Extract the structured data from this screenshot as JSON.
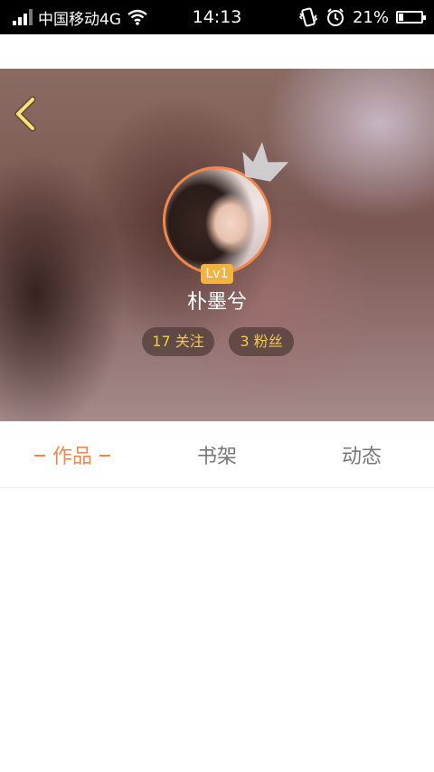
{
  "status_bar": {
    "carrier": "中国移动4G",
    "time": "14:13",
    "battery_percent": "21%",
    "battery_level": 0.21
  },
  "profile": {
    "level": "Lv1",
    "username": "朴墨兮",
    "following": "17 关注",
    "fans": "3 粉丝"
  },
  "tabs": [
    {
      "label": "作品",
      "active": true
    },
    {
      "label": "书架",
      "active": false
    },
    {
      "label": "动态",
      "active": false
    }
  ],
  "colors": {
    "accent": "#f0874c",
    "level_badge": "#f0b43f",
    "stat_text": "#f3c94a",
    "inactive_tab": "#777777"
  },
  "icons": {
    "back": "chevron-left-icon",
    "crown": "crown-icon",
    "wifi": "wifi-icon",
    "vibrate": "vibrate-icon",
    "alarm": "alarm-icon",
    "battery": "battery-icon",
    "signal": "signal-icon"
  }
}
